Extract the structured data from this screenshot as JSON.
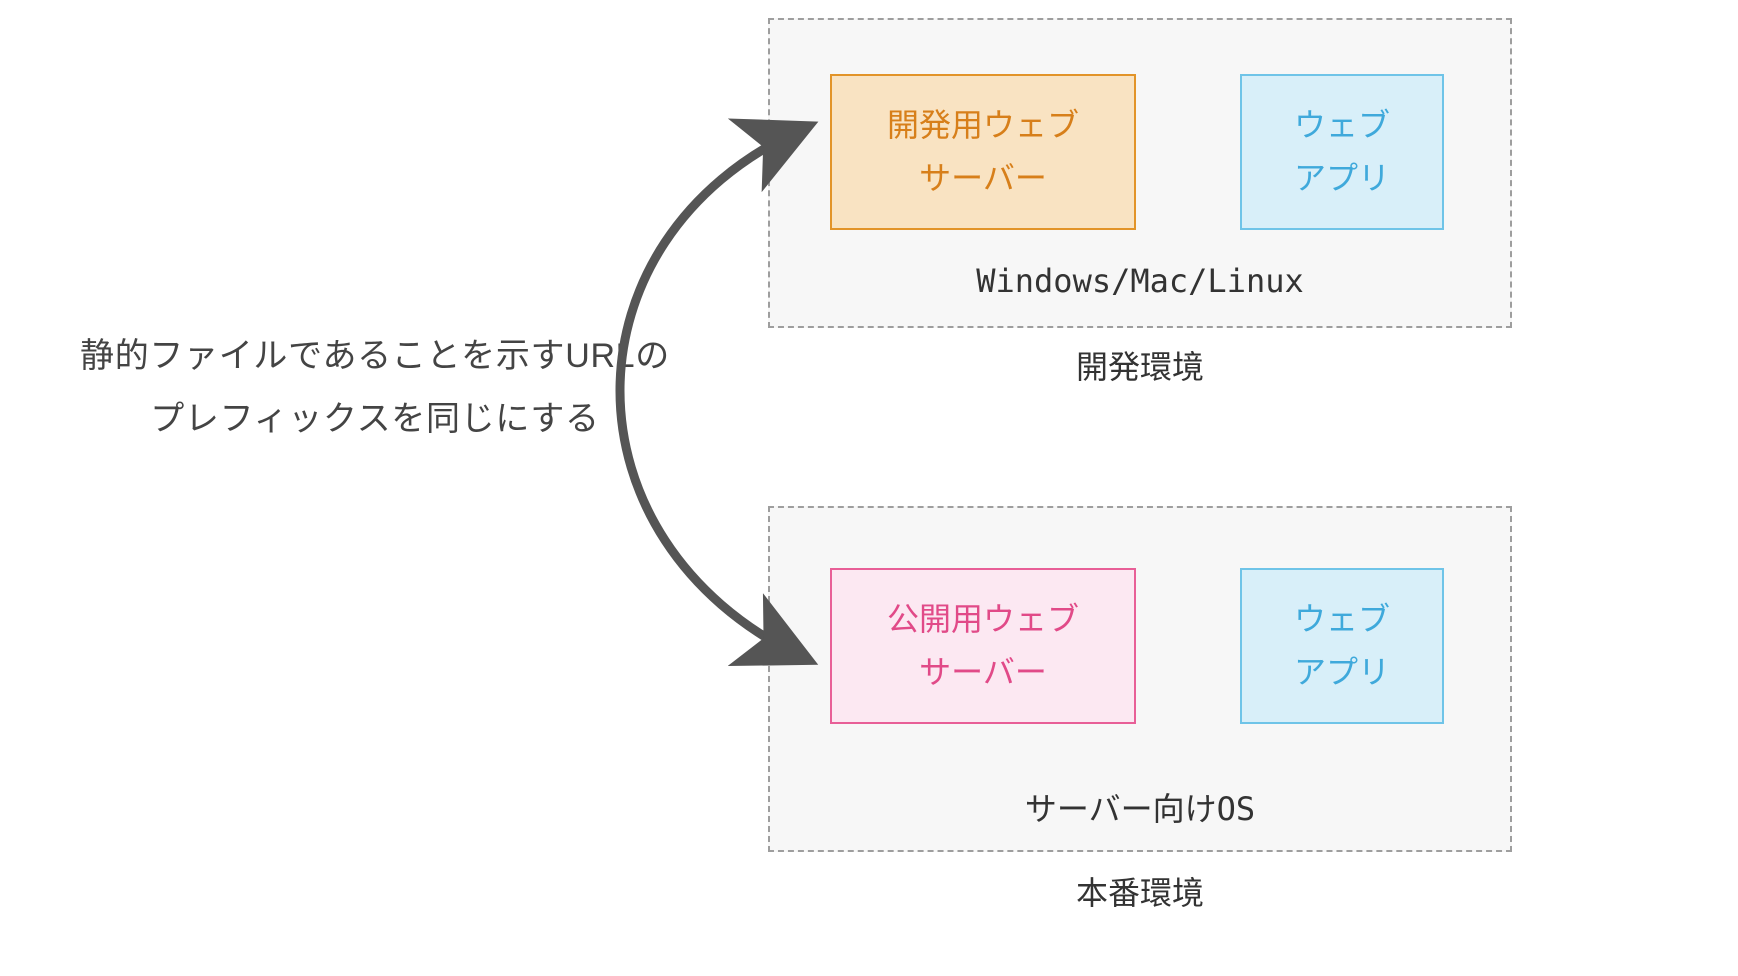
{
  "caption": {
    "line1": "静的ファイルであることを示すURLの",
    "line2": "プレフィックスを同じにする"
  },
  "environments": {
    "dev": {
      "server_line1": "開発用ウェブ",
      "server_line2": "サーバー",
      "app_line1": "ウェブ",
      "app_line2": "アプリ",
      "os_label": "Windows/Mac/Linux",
      "env_label": "開発環境"
    },
    "prod": {
      "server_line1": "公開用ウェブ",
      "server_line2": "サーバー",
      "app_line1": "ウェブ",
      "app_line2": "アプリ",
      "os_label": "サーバー向けOS",
      "env_label": "本番環境"
    }
  },
  "colors": {
    "dev_server_border": "#e29429",
    "dev_server_fill": "#f9e3c2",
    "prod_server_border": "#e85f97",
    "prod_server_fill": "#fce8f2",
    "app_border": "#6fc4e8",
    "app_fill": "#d8eff9",
    "env_fill": "#f7f7f7",
    "env_border": "#9e9e9e",
    "arrow": "#555555"
  }
}
